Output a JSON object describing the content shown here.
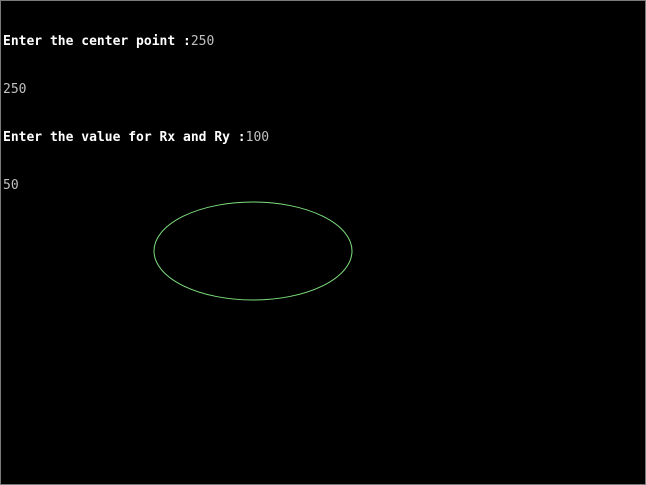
{
  "console": {
    "lines": [
      {
        "prompt": "Enter the center point :",
        "input": "250"
      },
      {
        "prompt": "",
        "input": "250"
      },
      {
        "prompt": "Enter the value for Rx and Ry :",
        "input": "100"
      },
      {
        "prompt": "",
        "input": "50"
      }
    ]
  },
  "drawing": {
    "shape": "ellipse",
    "stroke_color": "#7ee07e"
  },
  "colors": {
    "background": "#000000",
    "prompt_text": "#ffffff",
    "input_text": "#c0c0c0"
  }
}
